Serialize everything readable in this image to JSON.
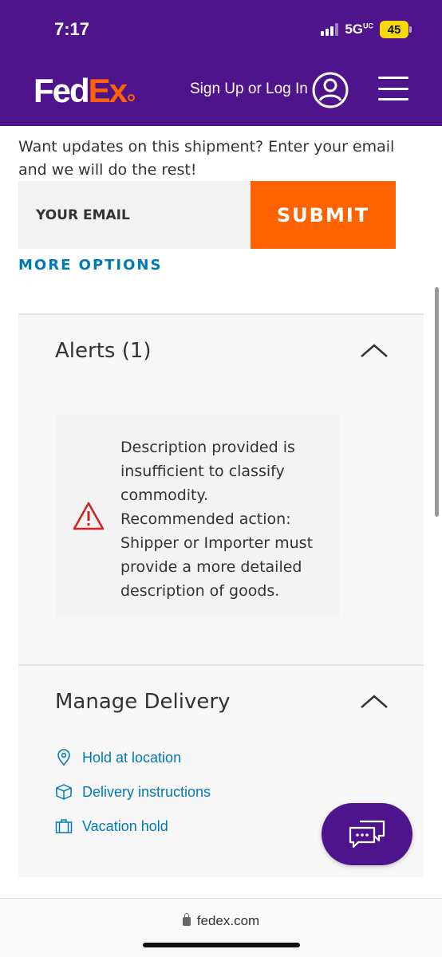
{
  "status_bar": {
    "time": "7:17",
    "network": "5G",
    "network_sup": "UC",
    "battery": "45"
  },
  "header": {
    "logo_fed": "Fed",
    "logo_ex": "Ex",
    "signin_label": "Sign Up or Log In"
  },
  "email_signup": {
    "prompt": "Want updates on this shipment? Enter your email and we will do the rest!",
    "placeholder": "YOUR EMAIL",
    "submit_label": "SUBMIT",
    "more_options": "MORE OPTIONS"
  },
  "alerts": {
    "title": "Alerts (1)",
    "items": [
      {
        "line1": "Description provided is insufficient to classify commodity.",
        "line2": "Recommended action: Shipper or Importer must provide a more detailed description of goods."
      }
    ]
  },
  "manage_delivery": {
    "title": "Manage Delivery",
    "actions": [
      {
        "label": "Hold at location",
        "icon": "location-pin-icon"
      },
      {
        "label": "Delivery instructions",
        "icon": "package-icon"
      },
      {
        "label": "Vacation hold",
        "icon": "suitcase-icon"
      }
    ]
  },
  "browser": {
    "url": "fedex.com"
  },
  "colors": {
    "brand_purple": "#4d148c",
    "brand_orange": "#ff6200",
    "link_blue": "#007ab7",
    "alert_red": "#d81e1e"
  }
}
